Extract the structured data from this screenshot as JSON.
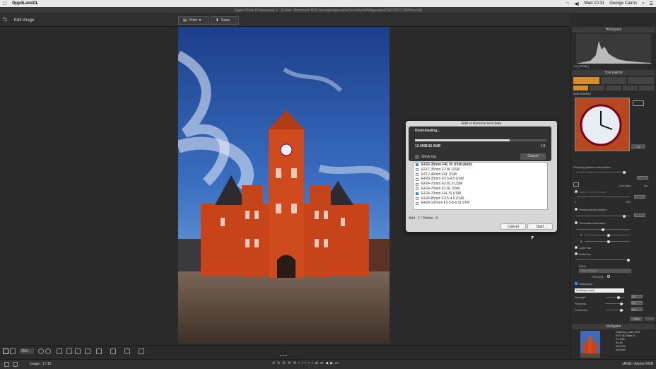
{
  "menubar": {
    "apple": "",
    "app_name": "Dpp4LensDL",
    "time": "Wed 10:31",
    "user": "George Cairns"
  },
  "window": {
    "title": "Digital Photo Professional 4 - [Folder: Macintosh HD/Users/georgecairns/Documents/Magazines/PRP/PRP106/Sources]"
  },
  "toolbar": {
    "back_icon": "arrow-left-icon",
    "title": "Edit image",
    "print_label": "Print",
    "print_arrow": "▾",
    "save_label": "Save"
  },
  "right_panel": {
    "histogram_title": "Histogram",
    "histogram_labels": "XY[ ]   RGB[ ]",
    "tool_palette_title": "Tool palette",
    "sub_window_title": "Sub-window",
    "zoom_selector": "1:1",
    "shooting_distance": "Shooting distance information",
    "lens_data_label": "Lens data :",
    "lens_data_value": "No",
    "digital_lens_optimizer": "Digital Lens Optimizer",
    "dlo_min": "0",
    "dlo_max": "100",
    "peripheral_illumination": "Peripheral illumination",
    "chromatic_aberration": "Chromatic aberration",
    "ca_r": "R",
    "ca_b": "B",
    "color_blur": "Color blur",
    "distortion": "Distortion",
    "effect_label": "Effect",
    "effect_value": "Shot settings",
    "fine_tune_label": "Fine-tune",
    "sharpness_label": "Sharpness",
    "unsharp_mask": "Unsharp mask",
    "strength_label": "Strength",
    "strength_value": "3.0",
    "fineness_label": "Fineness",
    "fineness_value": "4.0",
    "threshold_label": "Threshold",
    "threshold_value": "4.0",
    "copy_label": "Copy",
    "paste_label": "Paste",
    "navigator_title": "Navigator",
    "nav_info": [
      "Distortion_start.CR2",
      "EOS 5D Mark III",
      "Tv 1/80",
      "Av 16",
      "ISO 200",
      "16.0mm"
    ]
  },
  "dialog": {
    "title": "Add or Remove lens data",
    "downloading_title": "Downloading...",
    "progress_fraction": 0.72,
    "bytes": "12.0MB/16.5MB",
    "count": "1/1",
    "show_log_label": "Show log",
    "cancel_inner_label": "Cancel",
    "lenses": [
      {
        "name": "EF16-35mm F4L IS USM (Add)",
        "checked": true,
        "bold": true
      },
      {
        "name": "EF17-35mm F2.8L USM",
        "checked": false,
        "bold": false
      },
      {
        "name": "EF17-40mm F4L USM",
        "checked": false,
        "bold": false
      },
      {
        "name": "EF20-35mm F3.5-4.5 USM",
        "checked": false,
        "bold": false
      },
      {
        "name": "EF24-70mm F2.8L II USM",
        "checked": false,
        "bold": false
      },
      {
        "name": "EF24-70mm F2.8L USM",
        "checked": false,
        "bold": false
      },
      {
        "name": "EF24-70mm F4L IS USM",
        "checked": true,
        "bold": false
      },
      {
        "name": "EF24-85mm F3.5-4.5 USM",
        "checked": false,
        "bold": false
      },
      {
        "name": "EF24-105mm F3.5-5.6 IS STM",
        "checked": false,
        "bold": false
      }
    ],
    "summary": "Add : 1 / Delete : 0",
    "cancel_label": "Cancel",
    "start_label": "Start"
  },
  "statusbar": {
    "zoom": "25%"
  },
  "bottombar": {
    "image_count": "Image : 1 / 12",
    "color_profile": "sRGB / Adobe RGB"
  }
}
